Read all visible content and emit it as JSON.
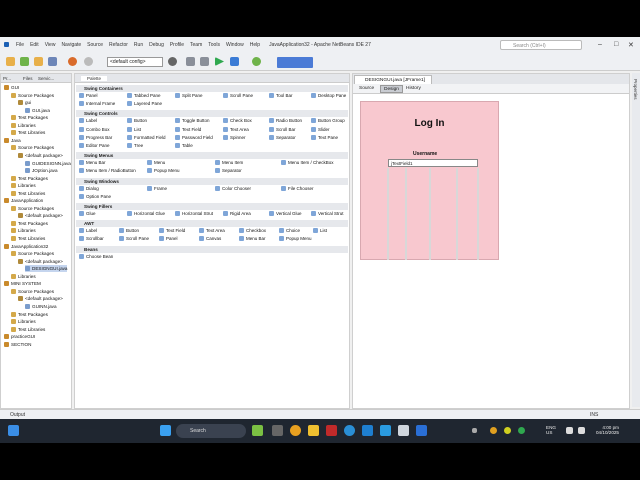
{
  "window": {
    "title": "JavaApplication32 - Apache NetBeans IDE 27",
    "menus": [
      "File",
      "Edit",
      "View",
      "Navigate",
      "Source",
      "Refactor",
      "Run",
      "Debug",
      "Profile",
      "Team",
      "Tools",
      "Window",
      "Help"
    ],
    "search_placeholder": "Search (Ctrl+I)",
    "config": "<default config>"
  },
  "left_tabs": [
    "Pr...",
    "Files",
    "Servic..."
  ],
  "tree": [
    "GUI",
    "Source Packages",
    "gui",
    "GUI.java",
    "Test Packages",
    "Libraries",
    "Test Libraries",
    "Java",
    "Source Packages",
    "<default package>",
    "GUIDESIGNN.java",
    "JOption.java",
    "Test Packages",
    "Libraries",
    "Test Libraries",
    "JavaApplication",
    "Source Packages",
    "<default package>",
    "Test Packages",
    "Libraries",
    "Test Libraries",
    "JavaApplication32",
    "Source Packages",
    "<default package>",
    "DESIGNGUI.java",
    "Libraries",
    "MINI SYSTEM",
    "Source Packages",
    "<default package>",
    "GUINN.java",
    "Test Packages",
    "Libraries",
    "Test Libraries",
    "practiceGUI",
    "SECTION"
  ],
  "palette": {
    "tab": "Palette",
    "categories": {
      "containers": "Swing Containers",
      "controls": "Swing Controls",
      "menus": "Swing Menus",
      "windows": "Swing Windows",
      "fillers": "Swing Fillers",
      "awt": "AWT",
      "beans": "Beans"
    },
    "containers": [
      "Panel",
      "Tabbed Pane",
      "Split Pane",
      "Scroll Pane",
      "Tool Bar",
      "Desktop Pane",
      "Internal Frame",
      "Layered Pane"
    ],
    "controls": [
      "Label",
      "Button",
      "Toggle Button",
      "Check Box",
      "Radio Button",
      "Button Group",
      "Combo Box",
      "List",
      "Text Field",
      "Text Area",
      "Scroll Bar",
      "Slider",
      "Progress Bar",
      "Formatted Field",
      "Password Field",
      "Spinner",
      "Separator",
      "Text Pane",
      "Editor Pane",
      "Tree",
      "Table"
    ],
    "menus": [
      "Menu Bar",
      "Menu",
      "Menu Item",
      "Menu Item / CheckBox",
      "Menu Item / RadioButton",
      "Popup Menu",
      "Separator"
    ],
    "windows": [
      "Dialog",
      "Frame",
      "Color Chooser",
      "File Chooser",
      "Option Pane"
    ],
    "fillers": [
      "Glue",
      "Horizontal Glue",
      "Horizontal Strut",
      "Rigid Area",
      "Vertical Glue",
      "Vertical Strut"
    ],
    "awt": [
      "Label",
      "Button",
      "Text Field",
      "Text Area",
      "Checkbox",
      "Choice",
      "List",
      "Scrollbar",
      "Scroll Pane",
      "Panel",
      "Canvas",
      "Menu Bar",
      "Popup Menu"
    ],
    "beans": [
      "Choose Bean"
    ]
  },
  "editor": {
    "tab": "DESIGNGUI.java [JFrame1]",
    "views": [
      "Source",
      "Design",
      "History"
    ],
    "form_title": "Log In",
    "form_label": "Username",
    "text_field": "jTextField1"
  },
  "properties_label": "Properties",
  "status": {
    "output": "Output",
    "mode": "INS"
  },
  "taskbar": {
    "search": "Search",
    "lang": "ENG",
    "region": "US",
    "time": "4:00 pm",
    "date": "04/10/2025"
  }
}
